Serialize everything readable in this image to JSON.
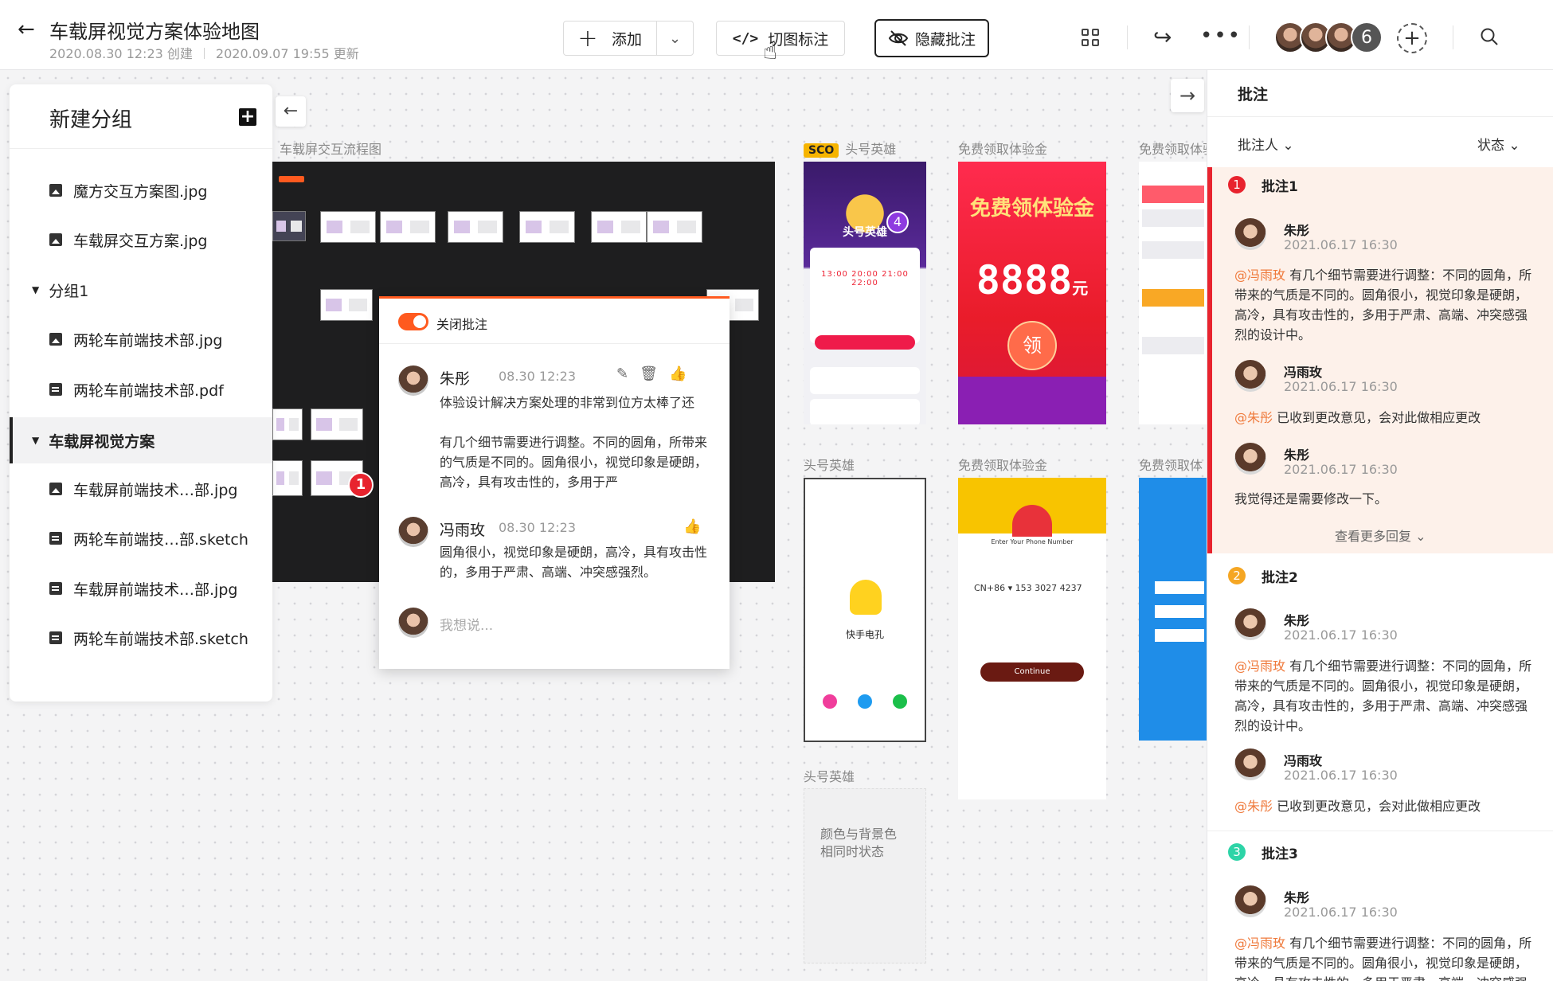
{
  "header": {
    "title": "车载屏视觉方案体验地图",
    "created": "2020.08.30 12:23 创建",
    "updated": "2020.09.07 19:55 更新",
    "add_label": "添加",
    "cut_label": "切图标注",
    "hide_label": "隐藏批注",
    "member_count": "6"
  },
  "sidebar": {
    "title": "新建分组",
    "items": [
      {
        "label": "魔方交互方案图.jpg",
        "icon": "image-icon"
      },
      {
        "label": "车载屏交互方案.jpg",
        "icon": "image-icon"
      },
      {
        "label": "分组1",
        "icon": "caret-down-icon"
      },
      {
        "label": "两轮车前端技术部.jpg",
        "icon": "image-icon"
      },
      {
        "label": "两轮车前端技术部.pdf",
        "icon": "doc-icon"
      },
      {
        "label": "车载屏视觉方案",
        "icon": "caret-down-icon"
      },
      {
        "label": "车载屏前端技术…部.jpg",
        "icon": "image-icon"
      },
      {
        "label": "两轮车前端技…部.sketch",
        "icon": "doc-icon"
      },
      {
        "label": "车载屏前端技术…部.jpg",
        "icon": "doc-icon"
      },
      {
        "label": "两轮车前端技术部.sketch",
        "icon": "doc-icon"
      }
    ]
  },
  "canvas": {
    "flow_label": "车载屏交互流程图",
    "pin_number": "1",
    "popup": {
      "toggle_label": "关闭批注",
      "comments": [
        {
          "name": "朱彤",
          "time": "08.30 12:23",
          "text1": "体验设计解决方案处理的非常到位方太棒了还",
          "text2": "有几个细节需要进行调整。不同的圆角，所带来的气质是不同的。圆角很小，视觉印象是硬朗，高冷，具有攻击性的，多用于严"
        },
        {
          "name": "冯雨玫",
          "time": "08.30 12:23",
          "text1": "圆角很小，视觉印象是硬朗，高冷，具有攻击性的，多用于严肃、高端、冲突感强烈。"
        }
      ],
      "input_placeholder": "我想说..."
    },
    "boards": [
      {
        "badge": "SCO",
        "label": "头号英雄"
      },
      {
        "label": "免费领取体验金"
      },
      {
        "label": "免费领取体验"
      },
      {
        "label": "头号英雄"
      },
      {
        "label": "免费领取体验金"
      },
      {
        "label": "免费领取体"
      },
      {
        "label": "头号英雄"
      }
    ],
    "screen1": {
      "badge": "4",
      "hero": "头号英雄",
      "prices": "13:00  20:00  21:00  22:00"
    },
    "screen2": {
      "heading": "免费领体验金",
      "amount": "8888",
      "unit": "元",
      "ling": "领"
    },
    "screen4": {
      "app": "快手电孔"
    },
    "screen5": {
      "line1": "Enter Your Phone Number",
      "phone": "CN+86 ▾    153 3027 4237",
      "continue": "Continue"
    },
    "placeholder_box": "颜色与背景色相同时状态"
  },
  "panel": {
    "title": "批注",
    "filter_person": "批注人",
    "filter_status": "状态",
    "more_replies": "查看更多回复",
    "annotations": [
      {
        "num": "1",
        "title": "批注1",
        "color": "#e8232e",
        "replies": [
          {
            "name": "朱彤",
            "time": "2021.06.17 16:30",
            "mention": "@冯雨玫",
            "text": " 有几个细节需要进行调整：不同的圆角，所带来的气质是不同的。圆角很小，视觉印象是硬朗，高冷，具有攻击性的，多用于严肃、高端、冲突感强烈的设计中。"
          },
          {
            "name": "冯雨玫",
            "time": "2021.06.17 16:30",
            "mention": "@朱彤",
            "text": " 已收到更改意见，会对此做相应更改"
          },
          {
            "name": "朱彤",
            "time": "2021.06.17 16:30",
            "mention": "",
            "text": "我觉得还是需要修改一下。"
          }
        ]
      },
      {
        "num": "2",
        "title": "批注2",
        "color": "#f5a623",
        "replies": [
          {
            "name": "朱彤",
            "time": "2021.06.17 16:30",
            "mention": "@冯雨玫",
            "text": " 有几个细节需要进行调整：不同的圆角，所带来的气质是不同的。圆角很小，视觉印象是硬朗，高冷，具有攻击性的，多用于严肃、高端、冲突感强烈的设计中。"
          },
          {
            "name": "冯雨玫",
            "time": "2021.06.17 16:30",
            "mention": "@朱彤",
            "text": " 已收到更改意见，会对此做相应更改"
          }
        ]
      },
      {
        "num": "3",
        "title": "批注3",
        "color": "#2dd4a7",
        "replies": [
          {
            "name": "朱彤",
            "time": "2021.06.17 16:30",
            "mention": "@冯雨玫",
            "text": " 有几个细节需要进行调整：不同的圆角，所带来的气质是不同的。圆角很小，视觉印象是硬朗，高冷，具有攻击性的，多用于严肃、高端、冲突感强烈的设计中。"
          }
        ]
      }
    ]
  }
}
